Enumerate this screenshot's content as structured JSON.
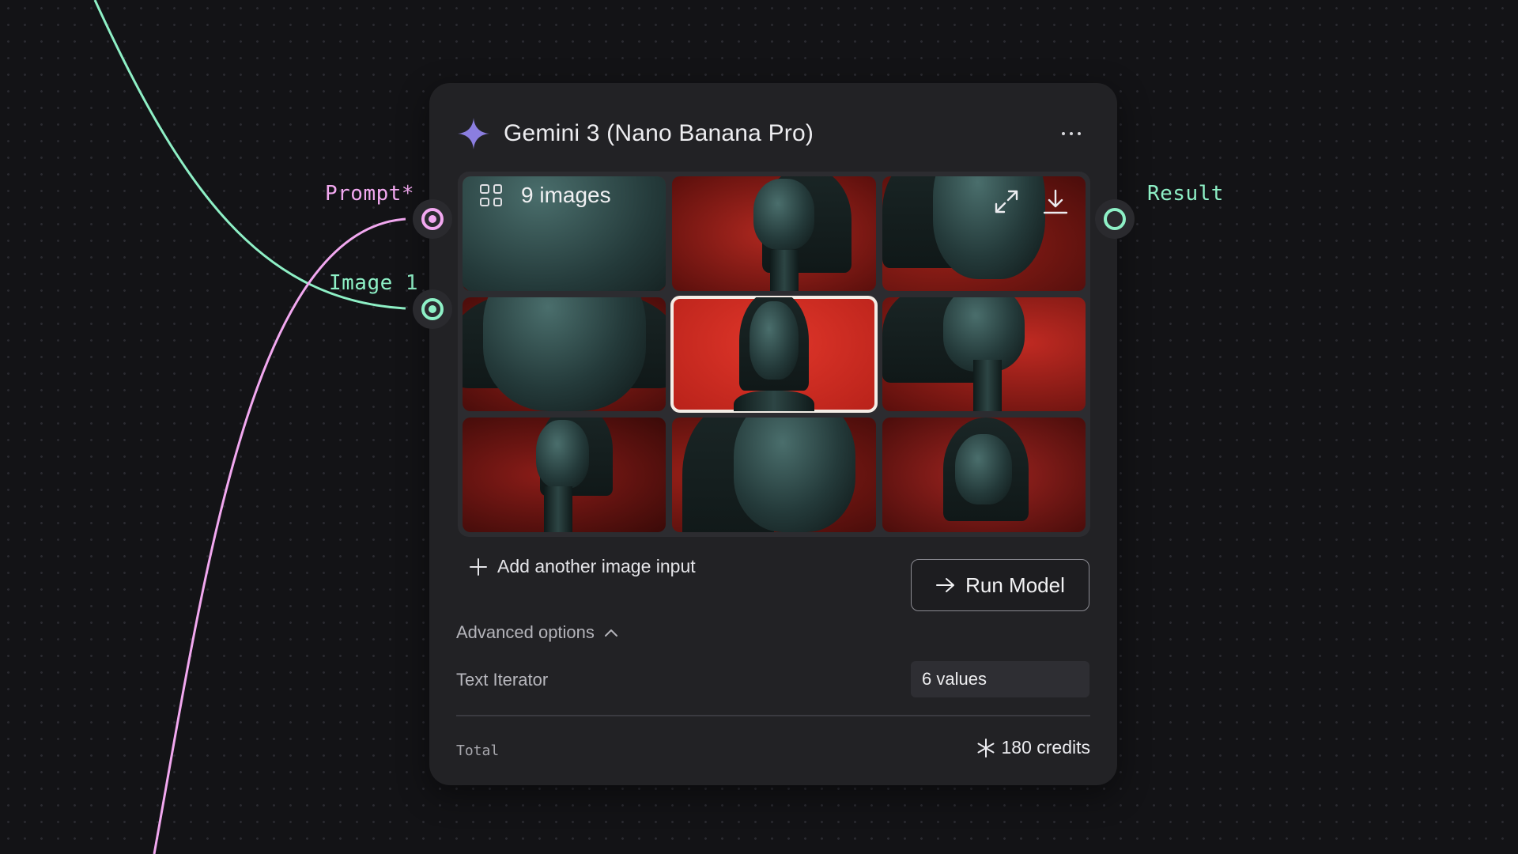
{
  "canvas": {
    "inputs": [
      {
        "label": "Prompt*",
        "color": "#f2a8f0"
      },
      {
        "label": "Image 1",
        "color": "#8ef0c6"
      }
    ],
    "output": {
      "label": "Result",
      "color": "#8ef0c6"
    }
  },
  "node": {
    "icon": "sparkle-icon",
    "accent_color": "#8b7ee0",
    "title": "Gemini 3 (Nano Banana Pro)",
    "menu_icon": "more-horizontal-icon",
    "gallery": {
      "count_label": "9 images",
      "grid_icon": "grid-view-icon",
      "expand_icon": "expand-icon",
      "download_icon": "download-icon",
      "selected_index": 4,
      "images": [
        {
          "subject": "close-up face, eyes closed, looking down"
        },
        {
          "subject": "profile facing left"
        },
        {
          "subject": "lower face profile, chin raised"
        },
        {
          "subject": "close-up lips and chin"
        },
        {
          "subject": "front-facing portrait, bob haircut"
        },
        {
          "subject": "profile facing right"
        },
        {
          "subject": "profile facing left, head lowered"
        },
        {
          "subject": "close-up face with hair, eyes closed"
        },
        {
          "subject": "head bowed, bob haircut"
        }
      ]
    },
    "add_input_label": "Add another image input",
    "run_button_label": "Run Model",
    "advanced_options_label": "Advanced options",
    "params": [
      {
        "label": "Text Iterator",
        "value": "6 values"
      }
    ],
    "total_label": "Total",
    "credits_label": "180 credits"
  }
}
